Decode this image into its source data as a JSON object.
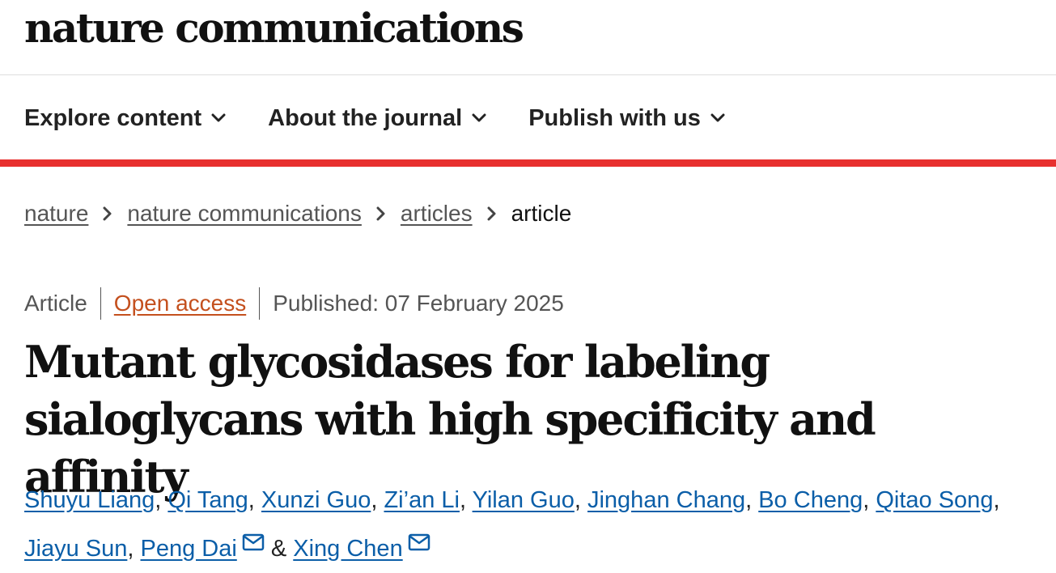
{
  "brand": {
    "logo_text": "nature communications"
  },
  "nav": {
    "items": [
      {
        "label": "Explore content"
      },
      {
        "label": "About the journal"
      },
      {
        "label": "Publish with us"
      }
    ]
  },
  "breadcrumb": {
    "items": [
      "nature",
      "nature communications",
      "articles"
    ],
    "current": "article"
  },
  "article": {
    "type": "Article",
    "access": "Open access",
    "published": "Published: 07 February 2025",
    "title": "Mutant glycosidases for labeling sialoglycans with high specificity and affinity",
    "authors": [
      "Shuyu Liang",
      "Qi Tang",
      "Xunzi Guo",
      "Zi’an Li",
      "Yilan Guo",
      "Jinghan Chang",
      "Bo Cheng",
      "Qitao Song",
      "Jiayu Sun",
      "Peng Dai",
      "Xing Chen"
    ],
    "comma": ",",
    "ampersand": "&"
  },
  "colors": {
    "accent_bar": "#e8302f",
    "open_access": "#c4501e",
    "author_link": "#0b5ea8"
  },
  "icons": {
    "nav_dropdown": "chevron-down-icon",
    "breadcrumb_separator": "chevron-right-icon",
    "corresponding_author": "mail-icon"
  }
}
